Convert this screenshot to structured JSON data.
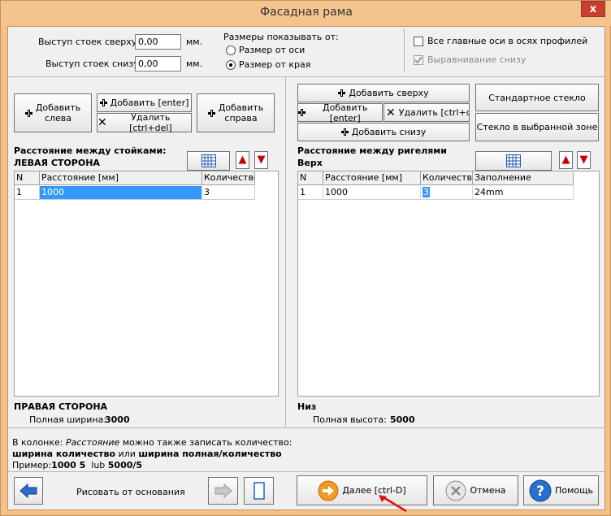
{
  "window": {
    "title": "Фасадная рама",
    "close_label": "x"
  },
  "top": {
    "overhang_top_label": "Выступ стоек сверху:",
    "overhang_top_value": "0,00",
    "overhang_bottom_label": "Выступ стоек снизу:",
    "overhang_bottom_value": "0,00",
    "unit": "мм.",
    "show_sizes_label": "Размеры показывать от:",
    "radio_axis": "Размер от оси",
    "radio_edge": "Размер от края",
    "check_main_axes": "Все главные оси в осях профилей",
    "check_align_bottom": "Выравнивание снизу"
  },
  "left": {
    "add_left": "Добавить\nслева",
    "add_enter": "Добавить [enter]",
    "delete": "Удалить [ctrl+del]",
    "add_right": "Добавить\nсправа",
    "section_title": "Расстояние между стойками:",
    "side_top": "ЛЕВАЯ СТОРОНА",
    "side_bottom": "ПРАВАЯ СТОРОНА",
    "total_label": "Полная ширина:",
    "total_value": "3000",
    "columns": [
      "N",
      "Расстояние [мм]",
      "Количество"
    ],
    "rows": [
      [
        "1",
        "1000",
        "3"
      ]
    ]
  },
  "right": {
    "add_top": "Добавить сверху",
    "add_enter": "Добавить [enter]",
    "delete": "Удалить [ctrl+del",
    "add_bottom": "Добавить снизу",
    "std_glass": "Стандартное стекло",
    "glass_zone": "Стекло в выбранной зоне",
    "section_title": "Расстояние между ригелями",
    "side_top": "Верх",
    "side_bottom": "Низ",
    "total_label": "Полная высота:",
    "total_value": "5000",
    "columns": [
      "N",
      "Расстояние [мм]",
      "Количество",
      "Заполнение"
    ],
    "rows": [
      [
        "1",
        "1000",
        "3",
        "24mm"
      ]
    ]
  },
  "hint": {
    "line1_pre": "В колонке: ",
    "line1_em": "Расстояние",
    "line1_post": " можно также записать количество:",
    "line2_b1": "ширина количество",
    "line2_mid": " или ",
    "line2_b2": "ширина полная/количество",
    "line3_pre": "Пример:",
    "line3_b1": "1000 5",
    "line3_mid": "  lub ",
    "line3_b2": "5000/5"
  },
  "bottom": {
    "draw_from_base": "Рисовать от основания",
    "next": "Далее [ctrl-D]",
    "cancel": "Отмена",
    "help": "Помощь"
  },
  "colors": {
    "selection": "#3399ff",
    "accent_arrow": "#cc0000",
    "back_arrow": "#2a6fd0"
  }
}
